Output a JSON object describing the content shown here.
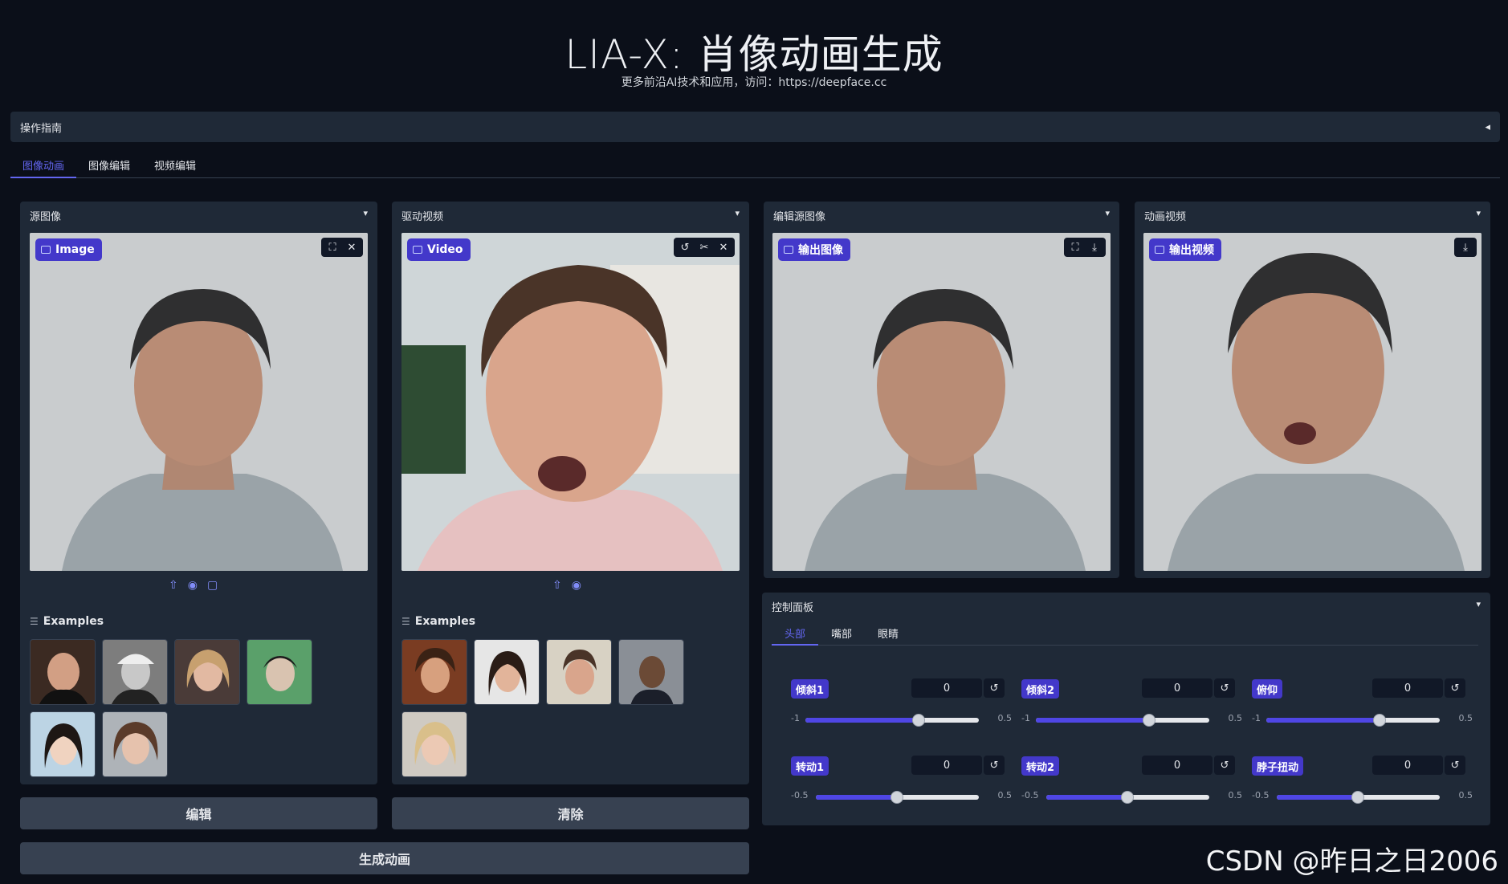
{
  "header": {
    "title": "LIA-X: 肖像动画生成",
    "subtitle": "更多前沿AI技术和应用，访问：https://deepface.cc"
  },
  "guide": {
    "label": "操作指南",
    "caret": "◂"
  },
  "tabs": [
    {
      "label": "图像动画",
      "active": true
    },
    {
      "label": "图像编辑"
    },
    {
      "label": "视频编辑"
    }
  ],
  "panels": {
    "source": {
      "label": "源图像",
      "badge": "Image",
      "examples_label": "Examples"
    },
    "driving": {
      "label": "驱动视频",
      "badge": "Video",
      "examples_label": "Examples"
    },
    "edited": {
      "label": "编辑源图像",
      "badge": "输出图像"
    },
    "animated": {
      "label": "动画视频",
      "badge": "输出视频"
    }
  },
  "buttons": {
    "edit": "编辑",
    "clear": "清除",
    "generate": "生成动画"
  },
  "control_panel": {
    "label": "控制面板",
    "tabs": [
      {
        "label": "头部",
        "active": true
      },
      {
        "label": "嘴部"
      },
      {
        "label": "眼睛"
      }
    ],
    "sliders": [
      {
        "label": "倾斜1",
        "value": "0",
        "min": "-1",
        "max": "0.5"
      },
      {
        "label": "倾斜2",
        "value": "0",
        "min": "-1",
        "max": "0.5"
      },
      {
        "label": "俯仰",
        "value": "0",
        "min": "-1",
        "max": "0.5"
      },
      {
        "label": "转动1",
        "value": "0",
        "min": "-0.5",
        "max": "0.5"
      },
      {
        "label": "转动2",
        "value": "0",
        "min": "-0.5",
        "max": "0.5"
      },
      {
        "label": "脖子扭动",
        "value": "0",
        "min": "-0.5",
        "max": "0.5"
      }
    ]
  },
  "watermark": "CSDN @昨日之日2006",
  "colors": {
    "accent": "#6366f1",
    "badge": "#4338ca",
    "panel": "#1f2937",
    "background": "#0b0f19"
  }
}
